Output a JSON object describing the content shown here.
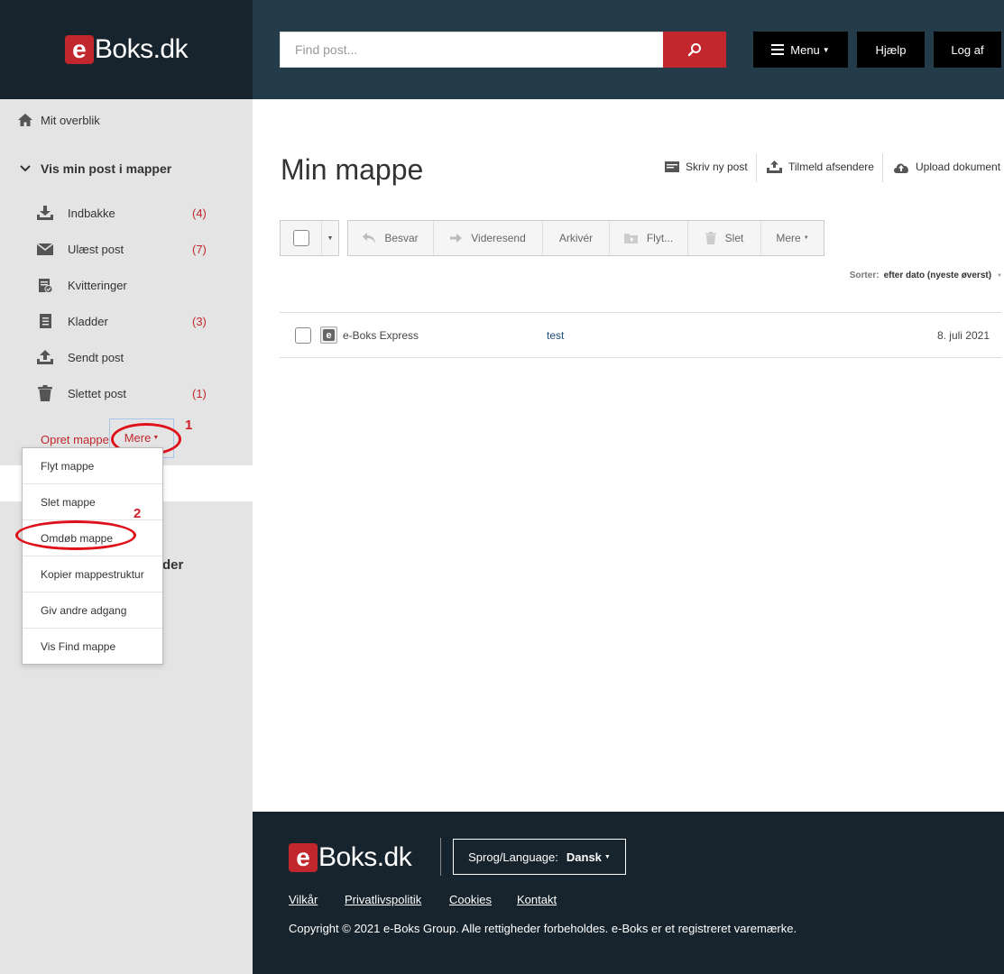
{
  "brand": {
    "logo_letter": "e",
    "logo_text": "Boks.dk"
  },
  "header": {
    "search_placeholder": "Find post...",
    "menu_label": "Menu",
    "help_label": "Hjælp",
    "logout_label": "Log af"
  },
  "sidebar": {
    "overview_label": "Mit overblik",
    "section_title": "Vis min post i mapper",
    "items": [
      {
        "label": "Indbakke",
        "count": "(4)",
        "icon": "inbox-download-icon"
      },
      {
        "label": "Ulæst post",
        "count": "(7)",
        "icon": "envelope-icon"
      },
      {
        "label": "Kvitteringer",
        "count": "",
        "icon": "receipt-icon"
      },
      {
        "label": "Kladder",
        "count": "(3)",
        "icon": "draft-document-icon"
      },
      {
        "label": "Sendt post",
        "count": "",
        "icon": "upload-icon"
      },
      {
        "label": "Slettet post",
        "count": "(1)",
        "icon": "trash-icon"
      }
    ],
    "create_folder_label": "Opret mappe",
    "more_label": "Mere",
    "partially_hidden_text": "der",
    "more_menu": [
      "Flyt mappe",
      "Slet mappe",
      "Omdøb mappe",
      "Kopier mappestruktur",
      "Giv andre adgang",
      "Vis Find mappe"
    ]
  },
  "annotations": {
    "step1": "1",
    "step2": "2",
    "color": "#e0101a"
  },
  "main": {
    "title": "Min mappe",
    "actions": [
      {
        "label": "Skriv ny post",
        "icon": "compose-icon"
      },
      {
        "label": "Tilmeld afsendere",
        "icon": "subscribe-icon"
      },
      {
        "label": "Upload dokument",
        "icon": "cloud-upload-icon"
      }
    ],
    "toolbar": {
      "reply": "Besvar",
      "forward": "Videresend",
      "archive": "Arkivér",
      "move": "Flyt...",
      "delete": "Slet",
      "more": "Mere"
    },
    "sort": {
      "label": "Sorter:",
      "value": "efter dato (nyeste øverst)"
    },
    "messages": [
      {
        "sender": "e-Boks Express",
        "subject": "test",
        "date": "8. juli 2021"
      }
    ]
  },
  "footer": {
    "language_label": "Sprog/Language:",
    "language_value": "Dansk",
    "links": [
      "Vilkår",
      "Privatlivspolitik",
      "Cookies",
      "Kontakt"
    ],
    "copyright": "Copyright © 2021 e-Boks Group. Alle rettigheder forbeholdes. e-Boks er et registreret varemærke."
  },
  "colors": {
    "brand_red": "#c1272d",
    "header_dark": "#17242d",
    "header_bar": "#243b4a",
    "sidebar_bg": "#e4e4e4"
  }
}
